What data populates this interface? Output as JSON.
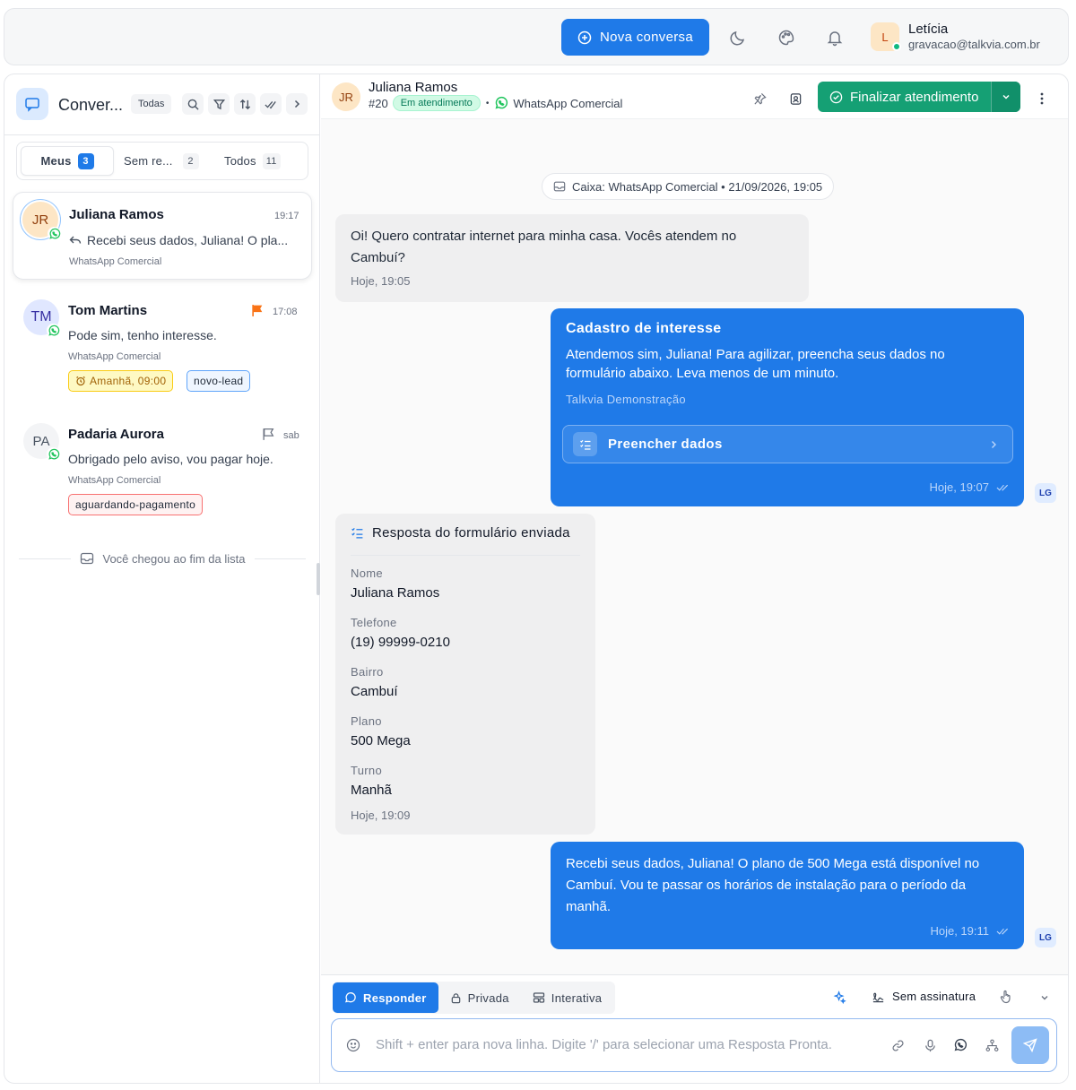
{
  "topbar": {
    "new_conversation": "Nova conversa",
    "user": {
      "initial": "L",
      "name": "Letícia",
      "email": "gravacao@talkvia.com.br"
    }
  },
  "sidebar": {
    "title": "Conver...",
    "filter_chip": "Todas",
    "tabs": [
      {
        "label": "Meus",
        "count": "3",
        "active": true
      },
      {
        "label": "Sem re...",
        "count": "2",
        "active": false
      },
      {
        "label": "Todos",
        "count": "11",
        "active": false
      }
    ],
    "conversations": [
      {
        "initials": "JR",
        "name": "Juliana Ramos",
        "time": "19:17",
        "preview": "Recebi seus dados, Juliana! O pla...",
        "source": "WhatsApp Comercial",
        "tags": []
      },
      {
        "initials": "TM",
        "name": "Tom Martins",
        "time": "17:08",
        "preview": "Pode sim, tenho interesse.",
        "source": "WhatsApp Comercial",
        "tags": [
          "Amanhã, 09:00",
          "novo-lead"
        ]
      },
      {
        "initials": "PA",
        "name": "Padaria Aurora",
        "time": "sab",
        "preview": "Obrigado pelo aviso, vou pagar hoje.",
        "source": "WhatsApp Comercial",
        "tags": [
          "aguardando-pagamento"
        ]
      }
    ],
    "end_of_list": "Você chegou ao fim da lista"
  },
  "chat": {
    "contact": {
      "initials": "JR",
      "name": "Juliana Ramos",
      "id": "#20",
      "status": "Em atendimento",
      "channel": "WhatsApp Comercial"
    },
    "finish_button": "Finalizar atendimento",
    "inbox_chip": "Caixa: WhatsApp Comercial • 21/09/2026, 19:05",
    "messages": {
      "m1": {
        "text": "Oi! Quero contratar internet para minha casa. Vocês atendem no Cambuí?",
        "time": "Hoje, 19:05"
      },
      "m2": {
        "title": "Cadastro de interesse",
        "text": "Atendemos sim, Juliana! Para agilizar, preencha seus dados no formulário abaixo. Leva menos de um minuto.",
        "footer": "Talkvia Demonstração",
        "button": "Preencher dados",
        "time": "Hoje, 19:07",
        "agent": "LG"
      },
      "m3": {
        "title": "Resposta do formulário enviada",
        "fields": [
          {
            "label": "Nome",
            "value": "Juliana Ramos"
          },
          {
            "label": "Telefone",
            "value": "(19) 99999-0210"
          },
          {
            "label": "Bairro",
            "value": "Cambuí"
          },
          {
            "label": "Plano",
            "value": "500 Mega"
          },
          {
            "label": "Turno",
            "value": "Manhã"
          }
        ],
        "time": "Hoje, 19:09"
      },
      "m4": {
        "text": "Recebi seus dados, Juliana! O plano de 500 Mega está disponível no Cambuí. Vou te passar os horários de instalação para o período da manhã.",
        "time": "Hoje, 19:11",
        "agent": "LG"
      }
    }
  },
  "composer": {
    "tabs": [
      "Responder",
      "Privada",
      "Interativa"
    ],
    "signature": "Sem assinatura",
    "placeholder": "Shift + enter para nova linha. Digite '/' para selecionar uma Resposta Pronta."
  },
  "colors": {
    "primary": "#1f7ae8",
    "success": "#15a074",
    "whatsapp": "#22c55e",
    "flag": "#f97316"
  }
}
